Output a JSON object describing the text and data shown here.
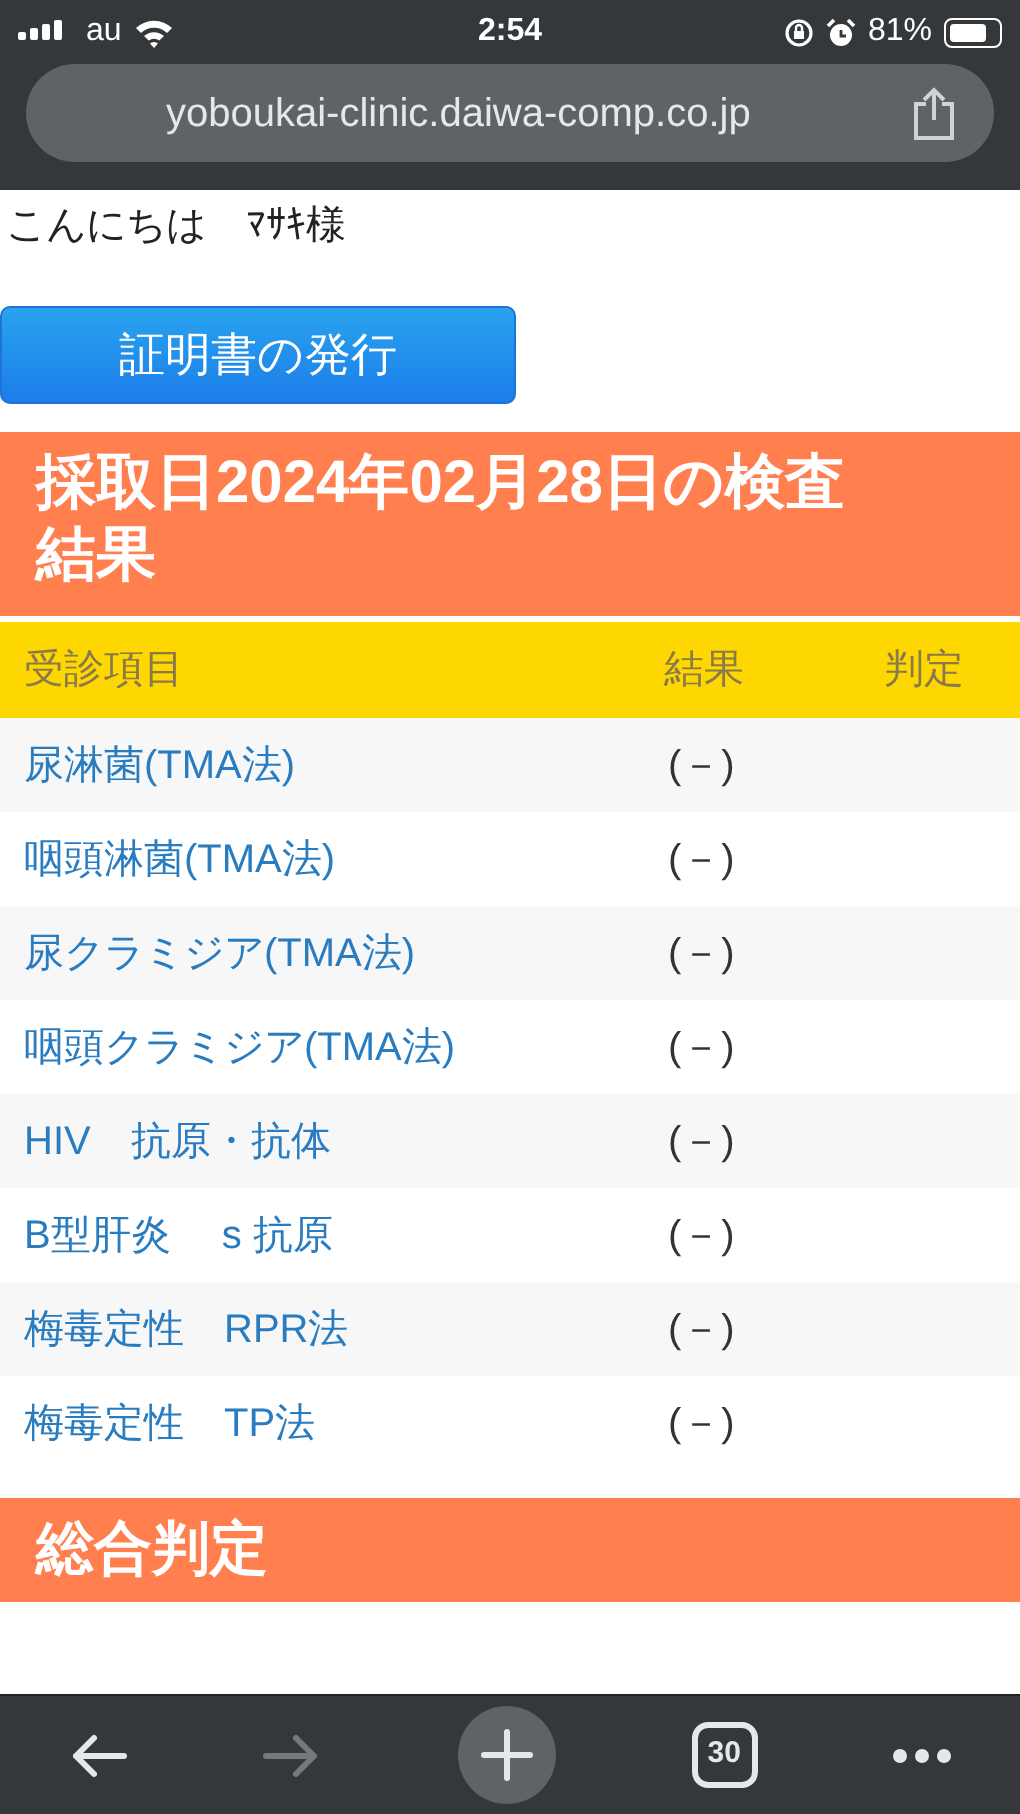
{
  "status_bar": {
    "carrier": "au",
    "time": "2:54",
    "battery": "81%"
  },
  "address_bar": {
    "url": "yoboukai-clinic.daiwa-comp.co.jp"
  },
  "greeting": "こんにちは　ﾏｻｷ様",
  "certificate_button": {
    "label": "証明書の発行"
  },
  "results_heading": "採取日2024年02月28日の検査結果",
  "table": {
    "columns": [
      "受診項目",
      "結果",
      "判定"
    ],
    "rows": [
      {
        "item": "尿淋菌(TMA法)",
        "result": "(－)"
      },
      {
        "item": "咽頭淋菌(TMA法)",
        "result": "(－)"
      },
      {
        "item": "尿クラミジア(TMA法)",
        "result": "(－)"
      },
      {
        "item": "咽頭クラミジア(TMA法)",
        "result": "(－)"
      },
      {
        "item": "HIV　抗原・抗体",
        "result": "(－)"
      },
      {
        "item": "B型肝炎　 s 抗原",
        "result": "(－)"
      },
      {
        "item": "梅毒定性　RPR法",
        "result": "(－)"
      },
      {
        "item": "梅毒定性　TP法",
        "result": "(－)"
      }
    ]
  },
  "overall_heading": "総合判定",
  "toolbar": {
    "back_disabled": false,
    "forward_disabled": true,
    "tab_count": "30"
  }
}
